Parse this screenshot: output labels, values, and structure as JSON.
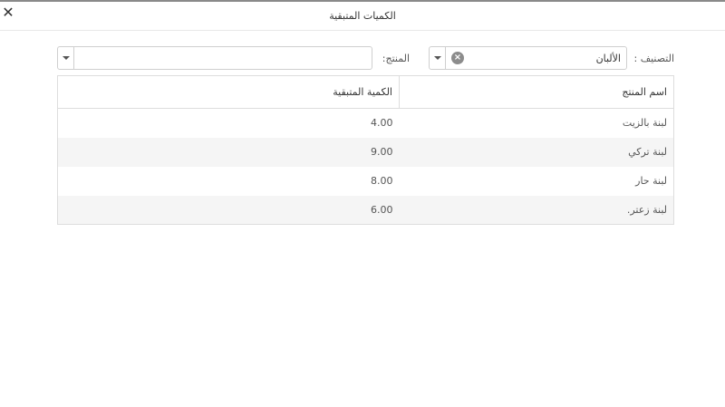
{
  "dialog": {
    "title": "الكميات المتبقية",
    "close_symbol": "✕"
  },
  "filters": {
    "category_label": "التصنيف :",
    "category_value": "الألبان",
    "clear_symbol": "×",
    "product_label": "المنتج:",
    "product_value": ""
  },
  "table": {
    "headers": [
      "اسم المنتج",
      "الكمية المتبقية"
    ],
    "rows": [
      {
        "name": "لبنة بالزيت",
        "qty": "4.00"
      },
      {
        "name": "لبنة تركي",
        "qty": "9.00"
      },
      {
        "name": "لبنة حار",
        "qty": "8.00"
      },
      {
        "name": "لبنة زعتر.",
        "qty": "6.00"
      }
    ]
  }
}
